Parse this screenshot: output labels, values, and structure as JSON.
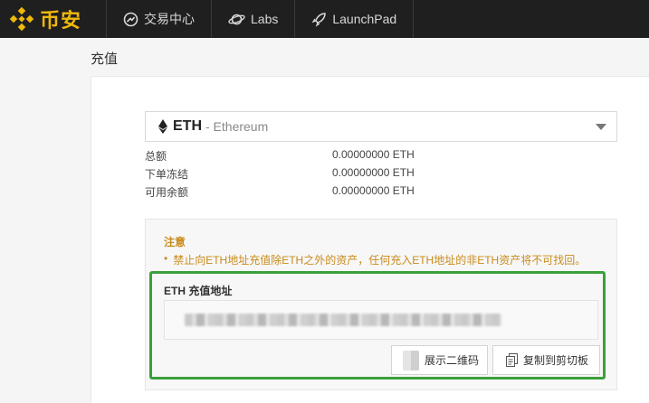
{
  "brand": {
    "name": "币安",
    "color": "#f0b90b"
  },
  "nav": [
    {
      "label": "交易中心",
      "icon": "trade-icon"
    },
    {
      "label": "Labs",
      "icon": "planet-icon"
    },
    {
      "label": "LaunchPad",
      "icon": "rocket-icon"
    }
  ],
  "page": {
    "title": "充值"
  },
  "coin": {
    "symbol": "ETH",
    "name": "- Ethereum"
  },
  "balances": [
    {
      "label": "总额",
      "value": "0.00000000 ETH"
    },
    {
      "label": "下单冻结",
      "value": "0.00000000 ETH"
    },
    {
      "label": "可用余额",
      "value": "0.00000000 ETH"
    }
  ],
  "notice": {
    "title": "注意",
    "bullet": "•",
    "text": "禁止向ETH地址充值除ETH之外的资产，任何充入ETH地址的非ETH资产将不可找回。",
    "color": "#c98b1c"
  },
  "deposit": {
    "label": "ETH 充值地址",
    "highlight_color": "#3aa03a",
    "show_qr_label": "展示二维码",
    "copy_label": "复制到剪切板"
  }
}
